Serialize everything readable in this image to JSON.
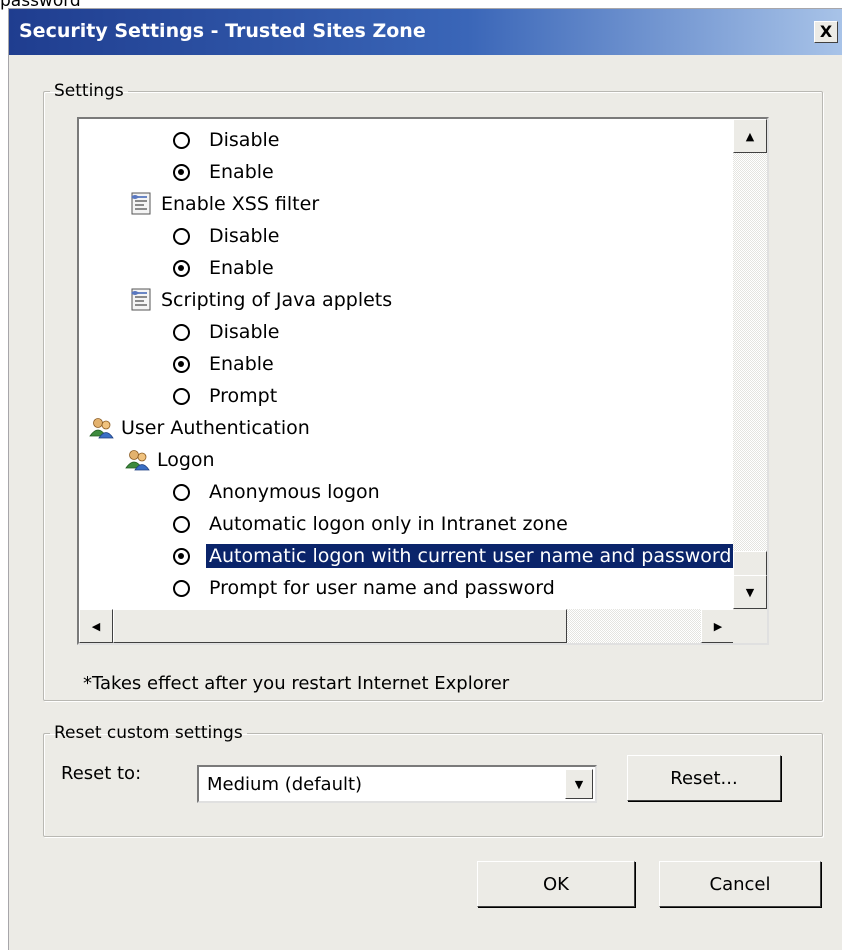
{
  "snippet_text": "password",
  "title": "Security Settings - Trusted Sites Zone",
  "close_label": "X",
  "settings": {
    "legend": "Settings",
    "items": [
      {
        "kind": "radio",
        "label": "Disable",
        "checked": false
      },
      {
        "kind": "radio",
        "label": "Enable",
        "checked": true
      },
      {
        "kind": "category",
        "icon": "script-settings-icon",
        "label": "Enable XSS filter"
      },
      {
        "kind": "radio",
        "label": "Disable",
        "checked": false
      },
      {
        "kind": "radio",
        "label": "Enable",
        "checked": true
      },
      {
        "kind": "category",
        "icon": "script-settings-icon",
        "label": "Scripting of Java applets"
      },
      {
        "kind": "radio",
        "label": "Disable",
        "checked": false
      },
      {
        "kind": "radio",
        "label": "Enable",
        "checked": true
      },
      {
        "kind": "radio",
        "label": "Prompt",
        "checked": false
      },
      {
        "kind": "category",
        "icon": "users-icon",
        "label": "User Authentication"
      },
      {
        "kind": "category",
        "icon": "users-icon",
        "label": "Logon"
      },
      {
        "kind": "radio",
        "label": "Anonymous logon",
        "checked": false
      },
      {
        "kind": "radio",
        "label": "Automatic logon only in Intranet zone",
        "checked": false
      },
      {
        "kind": "radio",
        "label": "Automatic logon with current user name and password",
        "checked": true,
        "selected": true
      },
      {
        "kind": "radio",
        "label": "Prompt for user name and password",
        "checked": false
      }
    ],
    "note": "*Takes effect after you restart Internet Explorer"
  },
  "reset": {
    "legend": "Reset custom settings",
    "reset_to_label": "Reset to:",
    "selected_level": "Medium (default)",
    "reset_button": "Reset..."
  },
  "buttons": {
    "ok": "OK",
    "cancel": "Cancel"
  }
}
